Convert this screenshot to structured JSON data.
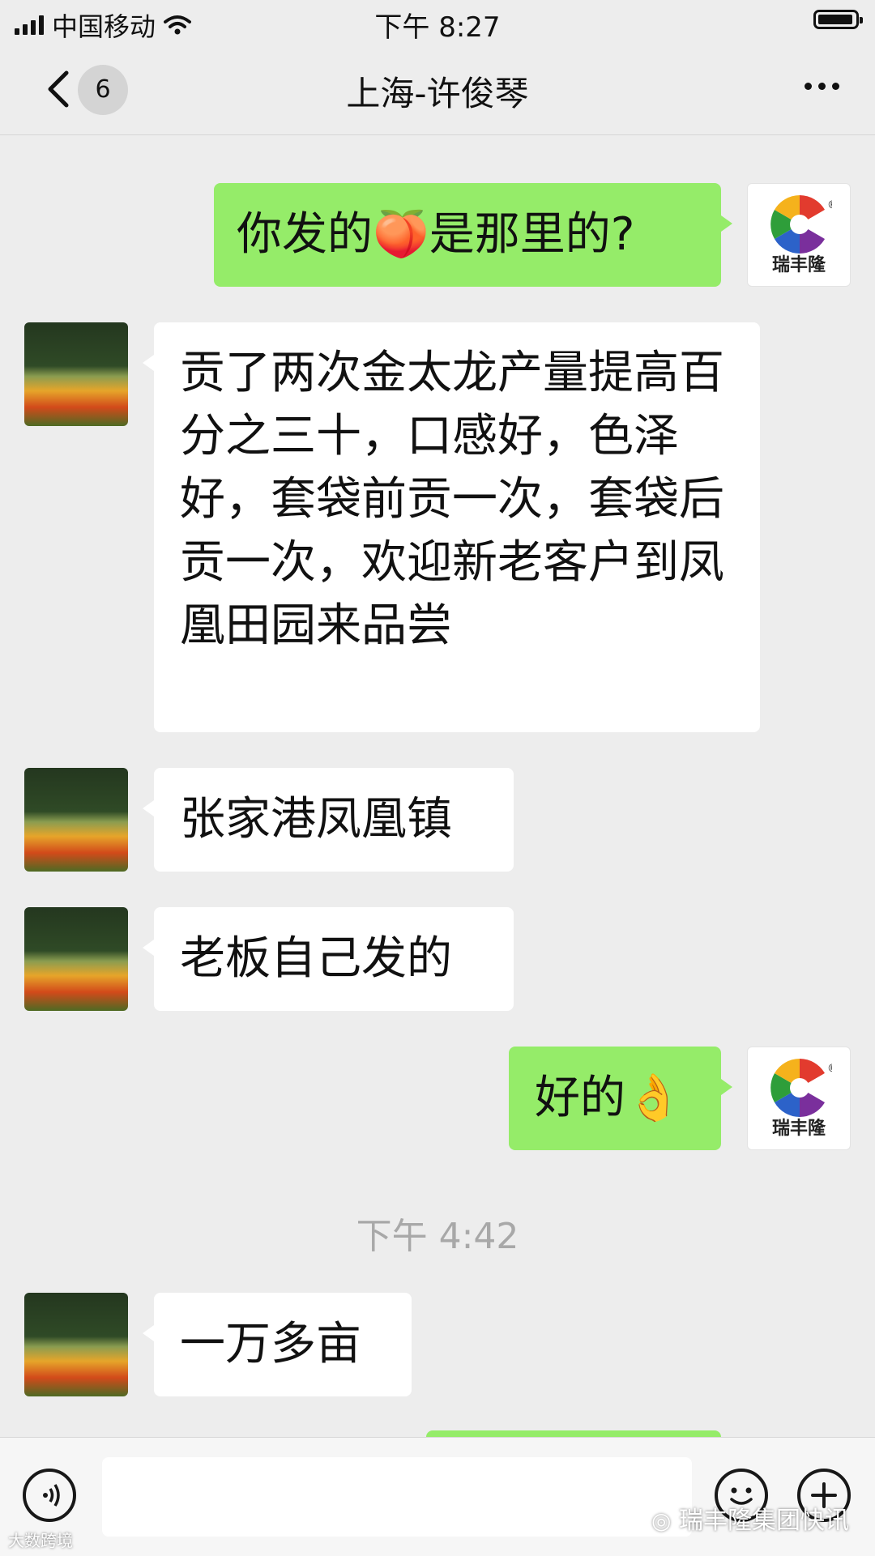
{
  "status_bar": {
    "carrier": "中国移动",
    "time": "下午 8:27"
  },
  "nav": {
    "unread_count": "6",
    "title": "上海-许俊琴"
  },
  "brand_avatar": {
    "text": "瑞丰隆",
    "mark": "®"
  },
  "messages": [
    {
      "side": "out",
      "text": "你发的🍑是那里的?"
    },
    {
      "side": "in",
      "text": "贡了两次金太龙产量提高百分之三十，口感好，色泽好，套袋前贡一次，套袋后贡一次，欢迎新老客户到凤凰田园来品尝"
    },
    {
      "side": "in",
      "text": "张家港凤凰镇"
    },
    {
      "side": "in",
      "text": "老板自己发的"
    },
    {
      "side": "out",
      "text": "好的👌"
    },
    {
      "side": "in",
      "text": "一万多亩"
    }
  ],
  "time_separator": "下午 4:42",
  "watermark": "瑞丰隆集团快讯",
  "watermark_small": "大数跨境"
}
